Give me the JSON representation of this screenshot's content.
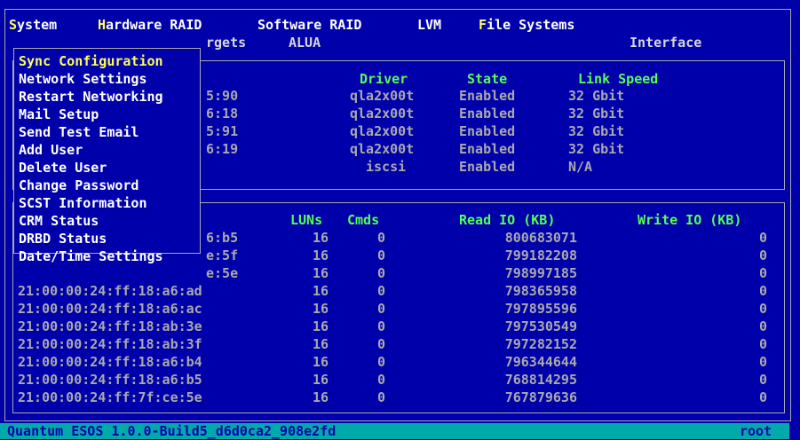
{
  "menubar": {
    "items": [
      {
        "hotkey": "S",
        "rest": "ystem"
      },
      {
        "hotkey": "H",
        "rest": "ardware RAID"
      },
      {
        "hotkey": "",
        "rest": "Software RAID"
      },
      {
        "hotkey": "",
        "rest": "LVM"
      },
      {
        "hotkey": "F",
        "rest": "ile Systems"
      }
    ]
  },
  "tabs_row": {
    "targets": "rgets",
    "alua": "ALUA",
    "interface": "Interface"
  },
  "targets_panel": {
    "headers": {
      "driver": "Driver",
      "state": "State",
      "link_speed": "Link Speed"
    },
    "rows": [
      {
        "wwn_tail": "5:90",
        "driver": "qla2x00t",
        "state": "Enabled",
        "speed": "32 Gbit"
      },
      {
        "wwn_tail": "6:18",
        "driver": "qla2x00t",
        "state": "Enabled",
        "speed": "32 Gbit"
      },
      {
        "wwn_tail": "5:91",
        "driver": "qla2x00t",
        "state": "Enabled",
        "speed": "32 Gbit"
      },
      {
        "wwn_tail": "6:19",
        "driver": "qla2x00t",
        "state": "Enabled",
        "speed": "32 Gbit"
      },
      {
        "wwn_tail": "",
        "driver": "iscsi",
        "state": "Enabled",
        "speed": "N/A"
      }
    ]
  },
  "stats_panel": {
    "headers": {
      "luns": "LUNs",
      "cmds": "Cmds",
      "read_io": "Read IO (KB)",
      "write_io": "Write IO (KB)"
    },
    "rows": [
      {
        "wwn": "6:b5",
        "luns": "16",
        "cmds": "0",
        "read": "800683071",
        "write": "0"
      },
      {
        "wwn": "e:5f",
        "luns": "16",
        "cmds": "0",
        "read": "799182208",
        "write": "0"
      },
      {
        "wwn": "e:5e",
        "luns": "16",
        "cmds": "0",
        "read": "798997185",
        "write": "0"
      },
      {
        "wwn": "21:00:00:24:ff:18:a6:ad",
        "luns": "16",
        "cmds": "0",
        "read": "798365958",
        "write": "0"
      },
      {
        "wwn": "21:00:00:24:ff:18:a6:ac",
        "luns": "16",
        "cmds": "0",
        "read": "797895596",
        "write": "0"
      },
      {
        "wwn": "21:00:00:24:ff:18:ab:3e",
        "luns": "16",
        "cmds": "0",
        "read": "797530549",
        "write": "0"
      },
      {
        "wwn": "21:00:00:24:ff:18:ab:3f",
        "luns": "16",
        "cmds": "0",
        "read": "797282152",
        "write": "0"
      },
      {
        "wwn": "21:00:00:24:ff:18:a6:b4",
        "luns": "16",
        "cmds": "0",
        "read": "796344644",
        "write": "0"
      },
      {
        "wwn": "21:00:00:24:ff:18:a6:b5",
        "luns": "16",
        "cmds": "0",
        "read": "768814295",
        "write": "0"
      },
      {
        "wwn": "21:00:00:24:ff:7f:ce:5e",
        "luns": "16",
        "cmds": "0",
        "read": "767879636",
        "write": "0"
      }
    ]
  },
  "system_menu": {
    "items": [
      "Sync Configuration",
      "Network Settings",
      "Restart Networking",
      "Mail Setup",
      "Send Test Email",
      "Add User",
      "Delete User",
      "Change Password",
      "SCST Information",
      "CRM Status",
      "DRBD Status",
      "Date/Time Settings"
    ],
    "selected_index": 0
  },
  "statusbar": {
    "version": "Quantum ESOS 1.0.0-Build5_d6d0ca2_908e2fd",
    "user": "root"
  },
  "colors": {
    "background": "#0000aa",
    "highlight": "#ffff55",
    "header": "#55ff55",
    "statusbar": "#00aaaa"
  }
}
